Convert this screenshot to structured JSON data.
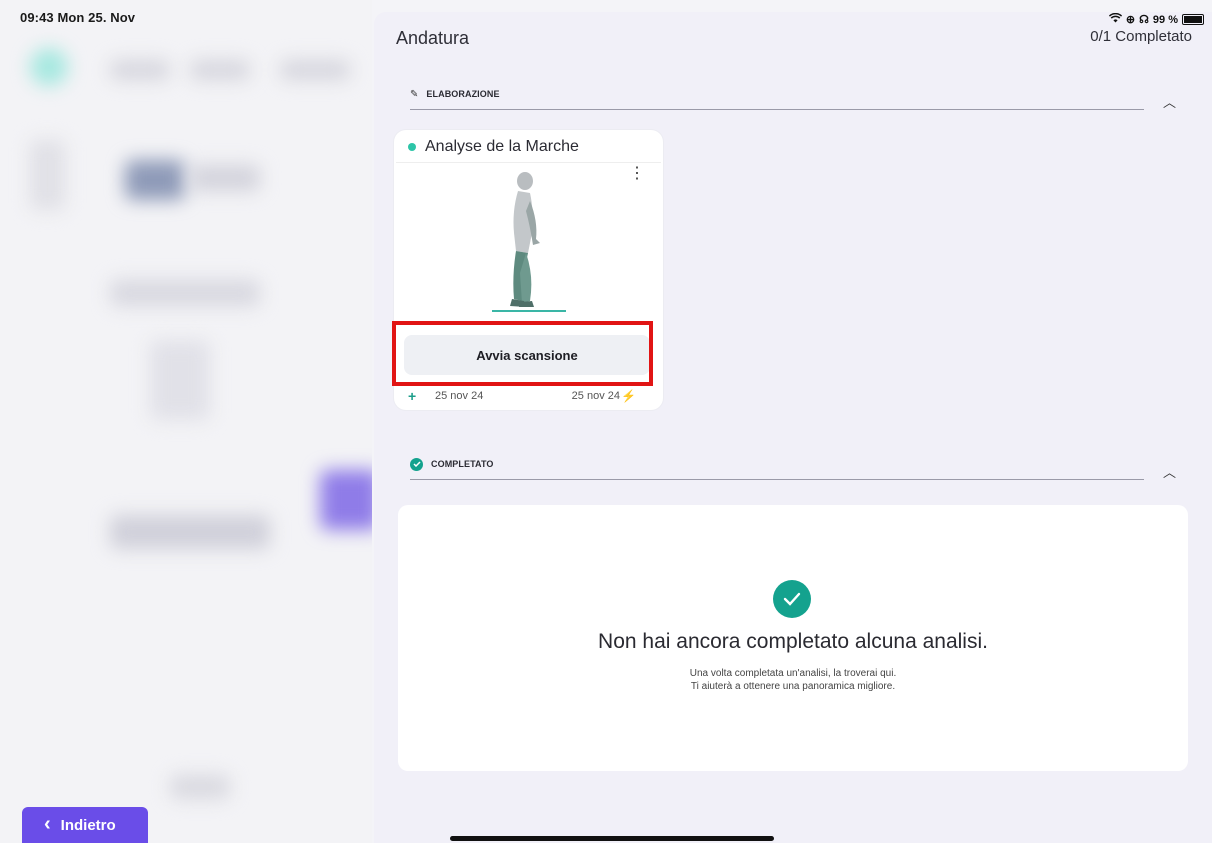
{
  "status_bar": {
    "time_date": "09:43  Mon 25. Nov",
    "battery": "99 %"
  },
  "back_button": {
    "label": "Indietro"
  },
  "panel": {
    "title": "Andatura",
    "progress": "0/1 Completato"
  },
  "sections": {
    "processing": {
      "label": "ELABORAZIONE"
    },
    "completed": {
      "label": "COMPLETATO"
    }
  },
  "card": {
    "title": "Analyse de la Marche",
    "button_label": "Avvia scansione",
    "created_date": "25 nov 24",
    "updated_date": "25 nov 24"
  },
  "empty_state": {
    "title": "Non hai ancora completato alcuna analisi.",
    "line1": "Una volta completata un'analisi, la troverai qui.",
    "line2": "Ti aiuterà a ottenere una panoramica migliore."
  },
  "colors": {
    "accent": "#6a4de8",
    "teal": "#14a28e",
    "status_dot": "#2dc5a8",
    "highlight": "#e11414"
  }
}
